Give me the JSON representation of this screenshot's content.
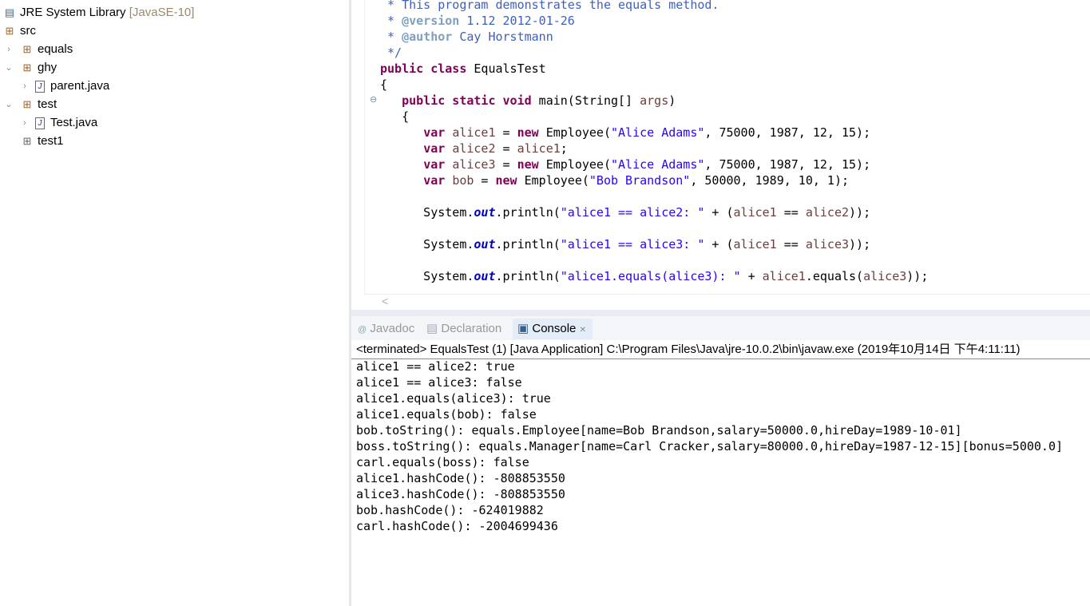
{
  "explorer": {
    "items": [
      {
        "label": "JRE System Library",
        "suffix": "[JavaSE-10]",
        "icon": "library-icon",
        "twisty": ""
      },
      {
        "label": "src",
        "icon": "source-folder-icon",
        "twisty": ""
      },
      {
        "label": "equals",
        "icon": "package-icon",
        "twisty": "›"
      },
      {
        "label": "ghy",
        "icon": "package-warning-icon",
        "twisty": "⌄"
      },
      {
        "label": "parent.java",
        "icon": "java-file-warning-icon",
        "twisty": "›"
      },
      {
        "label": "test",
        "icon": "package-warning-icon",
        "twisty": "⌄"
      },
      {
        "label": "Test.java",
        "icon": "java-file-warning-icon",
        "twisty": "›"
      },
      {
        "label": "test1",
        "icon": "empty-package-icon",
        "twisty": ""
      }
    ]
  },
  "editor": {
    "lines": [
      [
        [
          "doc",
          " * This program demonstrates the equals method."
        ]
      ],
      [
        [
          "doc",
          " * "
        ],
        [
          "tag",
          "@version"
        ],
        [
          "doc",
          " 1.12 2012-01-26"
        ]
      ],
      [
        [
          "doc",
          " * "
        ],
        [
          "tag",
          "@author"
        ],
        [
          "doc",
          " Cay Horstmann"
        ]
      ],
      [
        [
          "doc",
          " */"
        ]
      ],
      [
        [
          "kw",
          "public class"
        ],
        [
          "pl",
          " EqualsTest"
        ]
      ],
      [
        [
          "pl",
          "{"
        ]
      ],
      [
        [
          "pl",
          "   "
        ],
        [
          "kw",
          "public static void"
        ],
        [
          "pl",
          " main(String[] "
        ],
        [
          "var",
          "args"
        ],
        [
          "pl",
          ")"
        ]
      ],
      [
        [
          "pl",
          "   {"
        ]
      ],
      [
        [
          "pl",
          "      "
        ],
        [
          "kw",
          "var"
        ],
        [
          "pl",
          " "
        ],
        [
          "var",
          "alice1"
        ],
        [
          "pl",
          " = "
        ],
        [
          "kw",
          "new"
        ],
        [
          "pl",
          " Employee("
        ],
        [
          "str",
          "\"Alice Adams\""
        ],
        [
          "pl",
          ", 75000, 1987, 12, 15);"
        ]
      ],
      [
        [
          "pl",
          "      "
        ],
        [
          "kw",
          "var"
        ],
        [
          "pl",
          " "
        ],
        [
          "var",
          "alice2"
        ],
        [
          "pl",
          " = "
        ],
        [
          "var",
          "alice1"
        ],
        [
          "pl",
          ";"
        ]
      ],
      [
        [
          "pl",
          "      "
        ],
        [
          "kw",
          "var"
        ],
        [
          "pl",
          " "
        ],
        [
          "var",
          "alice3"
        ],
        [
          "pl",
          " = "
        ],
        [
          "kw",
          "new"
        ],
        [
          "pl",
          " Employee("
        ],
        [
          "str",
          "\"Alice Adams\""
        ],
        [
          "pl",
          ", 75000, 1987, 12, 15);"
        ]
      ],
      [
        [
          "pl",
          "      "
        ],
        [
          "kw",
          "var"
        ],
        [
          "pl",
          " "
        ],
        [
          "var",
          "bob"
        ],
        [
          "pl",
          " = "
        ],
        [
          "kw",
          "new"
        ],
        [
          "pl",
          " Employee("
        ],
        [
          "str",
          "\"Bob Brandson\""
        ],
        [
          "pl",
          ", 50000, 1989, 10, 1);"
        ]
      ],
      [],
      [
        [
          "pl",
          "      System."
        ],
        [
          "fld",
          "out"
        ],
        [
          "pl",
          ".println("
        ],
        [
          "str",
          "\"alice1 == alice2: \""
        ],
        [
          "pl",
          " + ("
        ],
        [
          "var",
          "alice1"
        ],
        [
          "pl",
          " == "
        ],
        [
          "var",
          "alice2"
        ],
        [
          "pl",
          "));"
        ]
      ],
      [],
      [
        [
          "pl",
          "      System."
        ],
        [
          "fld",
          "out"
        ],
        [
          "pl",
          ".println("
        ],
        [
          "str",
          "\"alice1 == alice3: \""
        ],
        [
          "pl",
          " + ("
        ],
        [
          "var",
          "alice1"
        ],
        [
          "pl",
          " == "
        ],
        [
          "var",
          "alice3"
        ],
        [
          "pl",
          "));"
        ]
      ],
      [],
      [
        [
          "pl",
          "      System."
        ],
        [
          "fld",
          "out"
        ],
        [
          "pl",
          ".println("
        ],
        [
          "str",
          "\"alice1.equals(alice3): \""
        ],
        [
          "pl",
          " + "
        ],
        [
          "var",
          "alice1"
        ],
        [
          "pl",
          ".equals("
        ],
        [
          "var",
          "alice3"
        ],
        [
          "pl",
          "));"
        ]
      ]
    ],
    "scroll_left": "<"
  },
  "tabs": [
    {
      "label": "Javadoc",
      "icon": "at-icon"
    },
    {
      "label": "Declaration",
      "icon": "declaration-icon"
    },
    {
      "label": "Console",
      "icon": "console-icon",
      "close": "✕"
    }
  ],
  "console": {
    "header": "<terminated> EqualsTest (1) [Java Application] C:\\Program Files\\Java\\jre-10.0.2\\bin\\javaw.exe (2019年10月14日 下午4:11:11)",
    "lines": [
      "alice1 == alice2: true",
      "alice1 == alice3: false",
      "alice1.equals(alice3): true",
      "alice1.equals(bob): false",
      "bob.toString(): equals.Employee[name=Bob Brandson,salary=50000.0,hireDay=1989-10-01]",
      "boss.toString(): equals.Manager[name=Carl Cracker,salary=80000.0,hireDay=1987-12-15][bonus=5000.0]",
      "carl.equals(boss): false",
      "alice1.hashCode(): -808853550",
      "alice3.hashCode(): -808853550",
      "bob.hashCode(): -624019882",
      "carl.hashCode(): -2004699436"
    ]
  }
}
